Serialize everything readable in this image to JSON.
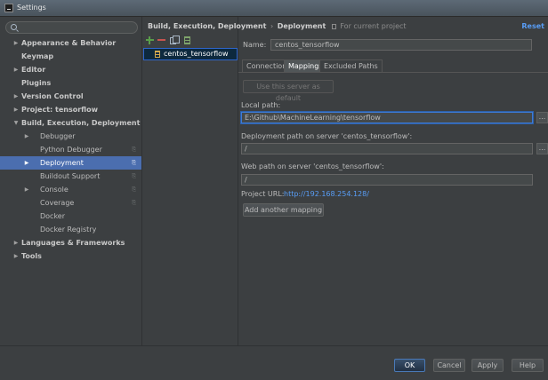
{
  "window": {
    "title": "Settings"
  },
  "search": {
    "placeholder": ""
  },
  "tree": [
    {
      "label": "Appearance & Behavior",
      "bold": true,
      "arrow": "▶",
      "level": 0
    },
    {
      "label": "Keymap",
      "bold": true,
      "arrow": "",
      "level": 0
    },
    {
      "label": "Editor",
      "bold": true,
      "arrow": "▶",
      "level": 0
    },
    {
      "label": "Plugins",
      "bold": true,
      "arrow": "",
      "level": 0
    },
    {
      "label": "Version Control",
      "bold": true,
      "arrow": "▶",
      "level": 0
    },
    {
      "label": "Project: tensorflow",
      "bold": true,
      "arrow": "▶",
      "level": 0
    },
    {
      "label": "Build, Execution, Deployment",
      "bold": true,
      "arrow": "▼",
      "level": 0
    },
    {
      "label": "Debugger",
      "bold": false,
      "arrow": "▶",
      "level": 1
    },
    {
      "label": "Python Debugger",
      "bold": false,
      "arrow": "",
      "level": 1,
      "copy": "⎘"
    },
    {
      "label": "Deployment",
      "bold": false,
      "arrow": "▶",
      "level": 1,
      "copy": "⎘",
      "selected": true
    },
    {
      "label": "Buildout Support",
      "bold": false,
      "arrow": "",
      "level": 1,
      "copy": "⎘"
    },
    {
      "label": "Console",
      "bold": false,
      "arrow": "▶",
      "level": 1,
      "copy": "⎘"
    },
    {
      "label": "Coverage",
      "bold": false,
      "arrow": "",
      "level": 1,
      "copy": "⎘"
    },
    {
      "label": "Docker",
      "bold": false,
      "arrow": "",
      "level": 1
    },
    {
      "label": "Docker Registry",
      "bold": false,
      "arrow": "",
      "level": 1
    },
    {
      "label": "Languages & Frameworks",
      "bold": true,
      "arrow": "▶",
      "level": 0
    },
    {
      "label": "Tools",
      "bold": true,
      "arrow": "▶",
      "level": 0
    }
  ],
  "breadcrumb": {
    "parent": "Build, Execution, Deployment",
    "separator": "›",
    "current": "Deployment",
    "note": "For current project"
  },
  "reset_label": "Reset",
  "servers": [
    {
      "label": "centos_tensorflow",
      "icon": "server-icon"
    }
  ],
  "form": {
    "name_label": "Name:",
    "name_value": "centos_tensorflow",
    "tabs": [
      "Connection",
      "Mappings",
      "Excluded Paths"
    ],
    "active_tab": "Mappings",
    "use_default_label": "Use this server as default",
    "local_path_label": "Local path:",
    "local_path_value": "E:\\Github\\MachineLearning\\tensorflow",
    "deployment_path_label": "Deployment path on server 'centos_tensorflow':",
    "deployment_path_value": "/",
    "web_path_label": "Web path on server 'centos_tensorflow':",
    "web_path_value": "/",
    "project_url_label": "Project URL:",
    "project_url_value": "http://192.168.254.128/",
    "add_mapping_label": "Add another mapping",
    "browse_label": "..."
  },
  "footer": {
    "ok": "OK",
    "cancel": "Cancel",
    "apply": "Apply",
    "help": "Help"
  },
  "colors": {
    "selection": "#4b6eaf",
    "link": "#589df6",
    "background": "#3c3f41"
  }
}
